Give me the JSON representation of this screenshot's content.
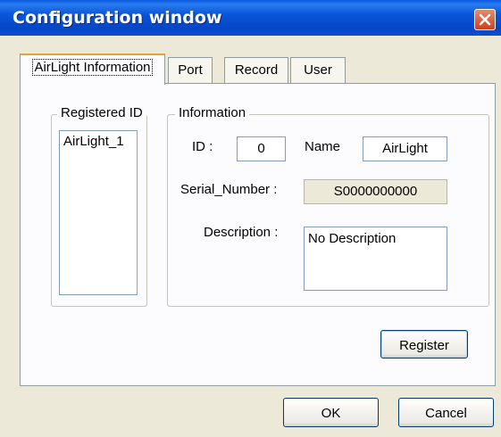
{
  "window": {
    "title": "Configuration window",
    "close_label": "close"
  },
  "tabs": [
    {
      "label": "AirLight Information",
      "active": true
    },
    {
      "label": "Port",
      "active": false
    },
    {
      "label": "Record",
      "active": false
    },
    {
      "label": "User",
      "active": false
    }
  ],
  "registered_group": {
    "label": "Registered ID",
    "items": [
      "AirLight_1"
    ]
  },
  "info_group": {
    "label": "Information",
    "id_label": "ID :",
    "id_value": "0",
    "name_label": "Name",
    "name_value": "AirLight",
    "serial_label": "Serial_Number :",
    "serial_value": "S0000000000",
    "description_label": "Description :",
    "description_value": "No Description"
  },
  "buttons": {
    "register": "Register",
    "ok": "OK",
    "cancel": "Cancel"
  },
  "colors": {
    "titlebar": "#0a55d8",
    "close": "#cc4020",
    "dialog_bg": "#ece9d8",
    "tab_accent": "#e7a33a"
  }
}
